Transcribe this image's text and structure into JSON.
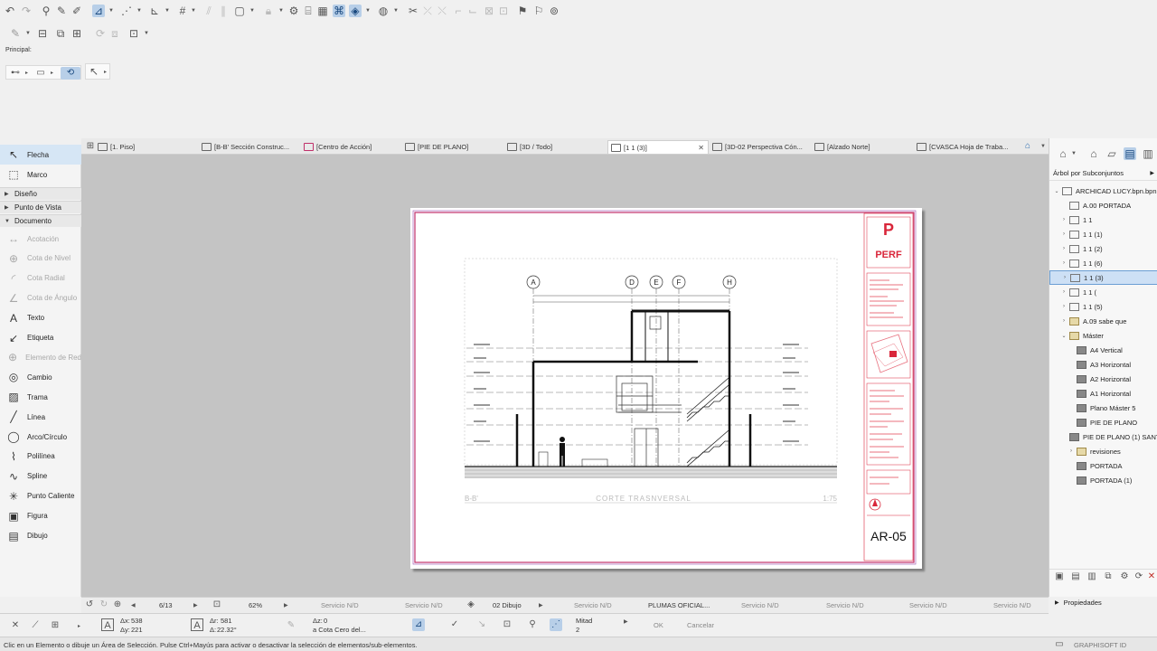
{
  "toolbar": {
    "principal_label": "Principal:"
  },
  "toolbox": {
    "tools_top": [
      {
        "label": "Flecha",
        "icon": "arrow-pointer-icon",
        "glyph": "↖"
      },
      {
        "label": "Marco",
        "icon": "marquee-icon",
        "glyph": "⬚"
      }
    ],
    "sections": [
      {
        "label": "Diseño",
        "expanded": false
      },
      {
        "label": "Punto de Vista",
        "expanded": false
      },
      {
        "label": "Documento",
        "expanded": true
      }
    ],
    "document_tools": [
      {
        "label": "Acotación",
        "icon": "dimension-icon",
        "glyph": "↔",
        "dim": true
      },
      {
        "label": "Cota de Nivel",
        "icon": "level-dimension-icon",
        "glyph": "⊕",
        "dim": true
      },
      {
        "label": "Cota Radial",
        "icon": "radial-dimension-icon",
        "glyph": "◜",
        "dim": true
      },
      {
        "label": "Cota de Ángulo",
        "icon": "angle-dimension-icon",
        "glyph": "∠",
        "dim": true
      },
      {
        "label": "Texto",
        "icon": "text-icon",
        "glyph": "A",
        "dim": false
      },
      {
        "label": "Etiqueta",
        "icon": "label-icon",
        "glyph": "↙",
        "dim": false
      },
      {
        "label": "Elemento de Red",
        "icon": "grid-element-icon",
        "glyph": "⊕",
        "dim": true
      },
      {
        "label": "Cambio",
        "icon": "change-icon",
        "glyph": "◎",
        "dim": false
      },
      {
        "label": "Trama",
        "icon": "fill-icon",
        "glyph": "▨",
        "dim": false
      },
      {
        "label": "Línea",
        "icon": "line-icon",
        "glyph": "╱",
        "dim": false
      },
      {
        "label": "Arco/Círculo",
        "icon": "arc-circle-icon",
        "glyph": "◯",
        "dim": false
      },
      {
        "label": "Polilínea",
        "icon": "polyline-icon",
        "glyph": "⌇",
        "dim": false
      },
      {
        "label": "Spline",
        "icon": "spline-icon",
        "glyph": "∿",
        "dim": false
      },
      {
        "label": "Punto Caliente",
        "icon": "hotspot-icon",
        "glyph": "✳",
        "dim": false
      },
      {
        "label": "Figura",
        "icon": "figure-icon",
        "glyph": "▣",
        "dim": false
      },
      {
        "label": "Dibujo",
        "icon": "drawing-icon",
        "glyph": "▤",
        "dim": false
      }
    ]
  },
  "tabs": [
    {
      "label": "[1. Piso]",
      "active": false
    },
    {
      "label": "[B-B' Sección Construc...",
      "active": false
    },
    {
      "label": "[Centro de Acción]",
      "active": false
    },
    {
      "label": "[PIE DE PLANO]",
      "active": false
    },
    {
      "label": "[3D / Todo]",
      "active": false
    },
    {
      "label": "[1 1 (3)]",
      "active": true
    },
    {
      "label": "[3D-02 Perspectiva Cón...",
      "active": false
    },
    {
      "label": "[Alzado Norte]",
      "active": false
    },
    {
      "label": "[CVASCA Hoja de Traba...",
      "active": false
    }
  ],
  "sheet": {
    "grid_labels": [
      "A",
      "D",
      "E",
      "F",
      "H"
    ],
    "drawing_id": "B-B'",
    "drawing_title": "CORTE TRASNVERSAL",
    "drawing_scale": "1:75",
    "title_block_logo": "PERF",
    "sheet_number": "AR-05"
  },
  "navigator": {
    "mode_label": "Árbol por Subconjuntos",
    "items": [
      {
        "label": "ARCHICAD LUCY.bpn.bpn",
        "depth": 0,
        "chev": "⌄",
        "kind": "sheet"
      },
      {
        "label": "A.00 PORTADA",
        "depth": 1,
        "chev": "",
        "kind": "sheet"
      },
      {
        "label": "1 1",
        "depth": 1,
        "chev": "›",
        "kind": "sheet"
      },
      {
        "label": "1 1 (1)",
        "depth": 1,
        "chev": "›",
        "kind": "sheet"
      },
      {
        "label": "1 1 (2)",
        "depth": 1,
        "chev": "›",
        "kind": "sheet"
      },
      {
        "label": "1 1 (6)",
        "depth": 1,
        "chev": "›",
        "kind": "sheet"
      },
      {
        "label": "1 1 (3)",
        "depth": 1,
        "chev": "›",
        "kind": "sheet",
        "selected": true
      },
      {
        "label": "1 1 (",
        "depth": 1,
        "chev": "›",
        "kind": "sheet"
      },
      {
        "label": "1 1 (5)",
        "depth": 1,
        "chev": "›",
        "kind": "sheet"
      },
      {
        "label": "A.09 sabe que",
        "depth": 1,
        "chev": "›",
        "kind": "folder"
      },
      {
        "label": "Máster",
        "depth": 1,
        "chev": "⌄",
        "kind": "folder"
      },
      {
        "label": "A4 Vertical",
        "depth": 2,
        "chev": "",
        "kind": "master"
      },
      {
        "label": "A3 Horizontal",
        "depth": 2,
        "chev": "",
        "kind": "master"
      },
      {
        "label": "A2 Horizontal",
        "depth": 2,
        "chev": "",
        "kind": "master"
      },
      {
        "label": "A1 Horizontal",
        "depth": 2,
        "chev": "",
        "kind": "master"
      },
      {
        "label": "Plano Máster 5",
        "depth": 2,
        "chev": "",
        "kind": "master"
      },
      {
        "label": "PIE DE PLANO",
        "depth": 2,
        "chev": "",
        "kind": "master"
      },
      {
        "label": "PIE DE PLANO (1) SANTI",
        "depth": 2,
        "chev": "",
        "kind": "master"
      },
      {
        "label": "revisiones",
        "depth": 2,
        "chev": "›",
        "kind": "folder"
      },
      {
        "label": "PORTADA",
        "depth": 2,
        "chev": "",
        "kind": "master"
      },
      {
        "label": "PORTADA (1)",
        "depth": 2,
        "chev": "",
        "kind": "master"
      }
    ],
    "properties_label": "Propiedades"
  },
  "statusrow": {
    "page": "6/13",
    "zoom": "62%",
    "service1": "Servicio N/D",
    "service2": "Servicio N/D",
    "layer": "02 Dibujo",
    "service3": "Servicio N/D",
    "pen_set": "PLUMAS OFICIAL...",
    "service4": "Servicio N/D",
    "service5": "Servicio N/D",
    "service6": "Servicio N/D",
    "service7": "Servicio N/D"
  },
  "infobox": {
    "dx_label": "Δx:",
    "dx_value": "538",
    "dy_label": "Δy:",
    "dy_value": "221",
    "dr_label": "Δr:",
    "dr_value": "581",
    "da_label": "Δ:",
    "da_value": "22.32°",
    "dz_label": "Δz:",
    "dz_value": "0",
    "ref_label": "a Cota Cero del...",
    "mitad_label": "Mitad",
    "mitad_value": "2",
    "ok_label": "OK",
    "cancel_label": "Cancelar"
  },
  "statusbar": {
    "message": "Clic en un Elemento o dibuje un Área de Selección. Pulse Ctrl+Mayús para activar o desactivar la selección de elementos/sub-elementos.",
    "brand": "GRAPHISOFT ID"
  },
  "colors": {
    "selection_blue": "#cde0f5",
    "sheet_border": "#c0306a",
    "drawing_red": "#d9263a"
  }
}
